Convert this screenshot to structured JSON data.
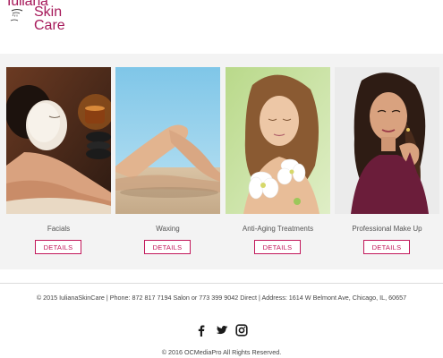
{
  "logo": {
    "line1": "Iuliana",
    "line2": "Skin",
    "line3": "Care",
    "accent_color": "#a6195a",
    "icon": "face-profile-icon"
  },
  "services": [
    {
      "title": "Facials",
      "button": "DETAILS",
      "image": "facial-mask-photo"
    },
    {
      "title": "Waxing",
      "button": "DETAILS",
      "image": "legs-beach-photo"
    },
    {
      "title": "Anti-Aging Treatments",
      "button": "DETAILS",
      "image": "woman-with-flowers-photo"
    },
    {
      "title": "Professional Make Up",
      "button": "DETAILS",
      "image": "makeup-portrait-photo"
    }
  ],
  "footer": {
    "contact": "© 2015 IulianaSkinCare | Phone: 872 817 7194 Salon or 773 399 9042 Direct | Address: 1614 W Belmont Ave, Chicago, IL, 60657",
    "social": [
      "facebook-icon",
      "twitter-icon",
      "instagram-icon"
    ],
    "copyright": "© 2016 OCMediaPro All Rights Reserved."
  },
  "colors": {
    "button_border": "#c2185b",
    "band_background": "#f3f3f3"
  }
}
